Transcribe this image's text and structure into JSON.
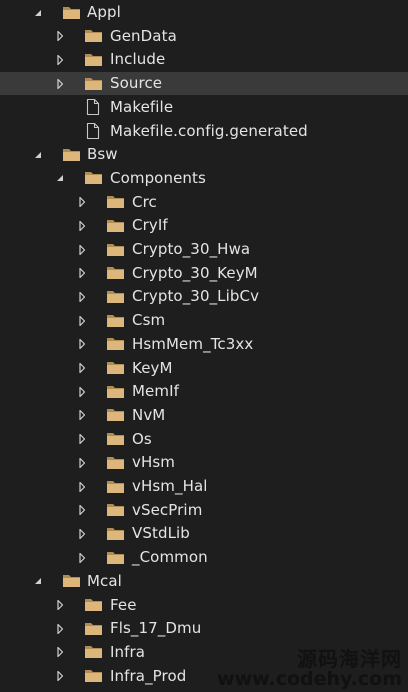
{
  "tree": [
    {
      "label": "Appl",
      "depth": 0,
      "type": "folder",
      "expander": "expanded",
      "selected": false
    },
    {
      "label": "GenData",
      "depth": 1,
      "type": "folder",
      "expander": "collapsed",
      "selected": false
    },
    {
      "label": "Include",
      "depth": 1,
      "type": "folder",
      "expander": "collapsed",
      "selected": false
    },
    {
      "label": "Source",
      "depth": 1,
      "type": "folder",
      "expander": "collapsed",
      "selected": true
    },
    {
      "label": "Makefile",
      "depth": 1,
      "type": "file",
      "expander": "none",
      "selected": false
    },
    {
      "label": "Makefile.config.generated",
      "depth": 1,
      "type": "file",
      "expander": "none",
      "selected": false
    },
    {
      "label": "Bsw",
      "depth": 0,
      "type": "folder",
      "expander": "expanded",
      "selected": false
    },
    {
      "label": "Components",
      "depth": 1,
      "type": "folder",
      "expander": "expanded",
      "selected": false
    },
    {
      "label": "Crc",
      "depth": 2,
      "type": "folder",
      "expander": "collapsed",
      "selected": false
    },
    {
      "label": "CryIf",
      "depth": 2,
      "type": "folder",
      "expander": "collapsed",
      "selected": false
    },
    {
      "label": "Crypto_30_Hwa",
      "depth": 2,
      "type": "folder",
      "expander": "collapsed",
      "selected": false
    },
    {
      "label": "Crypto_30_KeyM",
      "depth": 2,
      "type": "folder",
      "expander": "collapsed",
      "selected": false
    },
    {
      "label": "Crypto_30_LibCv",
      "depth": 2,
      "type": "folder",
      "expander": "collapsed",
      "selected": false
    },
    {
      "label": "Csm",
      "depth": 2,
      "type": "folder",
      "expander": "collapsed",
      "selected": false
    },
    {
      "label": "HsmMem_Tc3xx",
      "depth": 2,
      "type": "folder",
      "expander": "collapsed",
      "selected": false
    },
    {
      "label": "KeyM",
      "depth": 2,
      "type": "folder",
      "expander": "collapsed",
      "selected": false
    },
    {
      "label": "MemIf",
      "depth": 2,
      "type": "folder",
      "expander": "collapsed",
      "selected": false
    },
    {
      "label": "NvM",
      "depth": 2,
      "type": "folder",
      "expander": "collapsed",
      "selected": false
    },
    {
      "label": "Os",
      "depth": 2,
      "type": "folder",
      "expander": "collapsed",
      "selected": false
    },
    {
      "label": "vHsm",
      "depth": 2,
      "type": "folder",
      "expander": "collapsed",
      "selected": false
    },
    {
      "label": "vHsm_Hal",
      "depth": 2,
      "type": "folder",
      "expander": "collapsed",
      "selected": false
    },
    {
      "label": "vSecPrim",
      "depth": 2,
      "type": "folder",
      "expander": "collapsed",
      "selected": false
    },
    {
      "label": "VStdLib",
      "depth": 2,
      "type": "folder",
      "expander": "collapsed",
      "selected": false
    },
    {
      "label": "_Common",
      "depth": 2,
      "type": "folder",
      "expander": "collapsed",
      "selected": false
    },
    {
      "label": "Mcal",
      "depth": 0,
      "type": "folder",
      "expander": "expanded",
      "selected": false
    },
    {
      "label": "Fee",
      "depth": 1,
      "type": "folder",
      "expander": "collapsed",
      "selected": false
    },
    {
      "label": "Fls_17_Dmu",
      "depth": 1,
      "type": "folder",
      "expander": "collapsed",
      "selected": false
    },
    {
      "label": "Infra",
      "depth": 1,
      "type": "folder",
      "expander": "collapsed",
      "selected": false
    },
    {
      "label": "Infra_Prod",
      "depth": 1,
      "type": "folder",
      "expander": "collapsed",
      "selected": false
    }
  ],
  "watermark": {
    "line1": "源码海洋网",
    "line2": "www.codehy.com"
  },
  "colors": {
    "background": "#1e1e1e",
    "selected": "#3a3a3a",
    "folder": "#dcb67a",
    "text": "#e4e4e4",
    "expander": "#d0d0d0"
  }
}
